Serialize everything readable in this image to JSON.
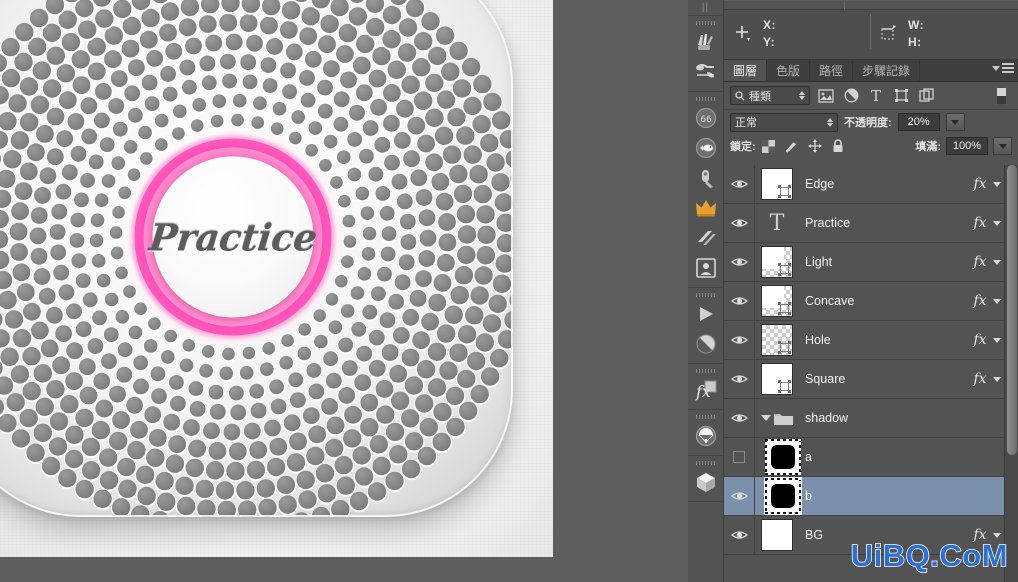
{
  "canvas": {
    "artwork_title": "Practice",
    "background_color": "#5e5e5e",
    "sheet_color": "#ffffff",
    "ring_color": "#ff46b4"
  },
  "toolbar": {
    "groups": [
      {
        "tools": [
          {
            "name": "sponge-dodge-tool",
            "glyph": "brush-set"
          },
          {
            "name": "blur-smudge-tool",
            "glyph": "smudge-set"
          }
        ]
      },
      {
        "tools": [
          {
            "name": "binoculars-tool",
            "glyph": "binoculars"
          },
          {
            "name": "fish-tool",
            "glyph": "fish"
          },
          {
            "name": "pocketknife-tool",
            "glyph": "knife"
          },
          {
            "name": "crown-tool",
            "glyph": "crown"
          },
          {
            "name": "stripes-tool",
            "glyph": "stripes"
          },
          {
            "name": "portrait-tool",
            "glyph": "portrait"
          }
        ]
      },
      {
        "tools": [
          {
            "name": "play-tool",
            "glyph": "play"
          },
          {
            "name": "circle-slash-tool",
            "glyph": "circle-slash"
          }
        ]
      },
      {
        "tools": [
          {
            "name": "fx-tool",
            "glyph": "fx"
          }
        ]
      },
      {
        "tools": [
          {
            "name": "parachute-tool",
            "glyph": "parachute"
          }
        ]
      },
      {
        "tools": [
          {
            "name": "cube-3d-tool",
            "glyph": "cube"
          }
        ]
      }
    ]
  },
  "info_bar": {
    "pointer_icon": "crosshair-icon",
    "x_label": "X:",
    "y_label": "Y:",
    "x_value": "",
    "y_value": "",
    "size_icon": "marquee-size-icon",
    "w_label": "W:",
    "h_label": "H:",
    "w_value": "",
    "h_value": ""
  },
  "panel": {
    "tabs": [
      {
        "label": "圖層",
        "name": "tab-layers",
        "active": true
      },
      {
        "label": "色版",
        "name": "tab-channels",
        "active": false
      },
      {
        "label": "路徑",
        "name": "tab-paths",
        "active": false
      },
      {
        "label": "步驟記錄",
        "name": "tab-history",
        "active": false
      }
    ],
    "menu_icon": "panel-menu-icon",
    "filter": {
      "kind_label": "種類",
      "search_icon": "search-icon",
      "icons": [
        {
          "name": "filter-pixel-icon"
        },
        {
          "name": "filter-adjustment-icon"
        },
        {
          "name": "filter-type-icon"
        },
        {
          "name": "filter-shape-icon"
        },
        {
          "name": "filter-smartobject-icon"
        }
      ],
      "toggle_name": "filter-toggle-switch"
    },
    "blend": {
      "mode": "正常",
      "opacity_label": "不透明度:",
      "opacity_value": "20%"
    },
    "lock": {
      "lock_label": "鎖定:",
      "icons": [
        {
          "name": "lock-transparent-pixels-icon"
        },
        {
          "name": "lock-image-pixels-icon"
        },
        {
          "name": "lock-position-icon"
        },
        {
          "name": "lock-all-icon"
        }
      ],
      "fill_label": "填滿:",
      "fill_value": "100%"
    }
  },
  "layers": [
    {
      "name": "Edge",
      "visible": true,
      "thumb": "shape-white",
      "fx": "fx",
      "selected": false,
      "child": false,
      "group": false
    },
    {
      "name": "Practice",
      "visible": true,
      "thumb": "type",
      "fx": "fx",
      "selected": false,
      "child": false,
      "group": false
    },
    {
      "name": "Light",
      "visible": true,
      "thumb": "shape-alpha",
      "fx": "fx",
      "selected": false,
      "child": false,
      "group": false
    },
    {
      "name": "Concave",
      "visible": true,
      "thumb": "shape-alpha",
      "fx": "fx",
      "selected": false,
      "child": false,
      "group": false
    },
    {
      "name": "Hole",
      "visible": true,
      "thumb": "alpha-only",
      "fx": "fx",
      "selected": false,
      "child": false,
      "group": false
    },
    {
      "name": "Square",
      "visible": true,
      "thumb": "shape-white",
      "fx": "fx",
      "selected": false,
      "child": false,
      "group": false
    },
    {
      "name": "shadow",
      "visible": true,
      "thumb": "folder",
      "fx": "",
      "selected": false,
      "child": false,
      "group": true
    },
    {
      "name": "a",
      "visible": false,
      "thumb": "black-squircle",
      "fx": "",
      "selected": false,
      "child": true,
      "group": false
    },
    {
      "name": "b",
      "visible": true,
      "thumb": "black-squircle",
      "fx": "",
      "selected": true,
      "child": true,
      "group": false
    },
    {
      "name": "BG",
      "visible": true,
      "thumb": "white-solid",
      "fx": "fx",
      "selected": false,
      "child": false,
      "group": false
    }
  ],
  "watermark": {
    "text": "UiBQ.CoM",
    "color": "#2a6fd4"
  }
}
